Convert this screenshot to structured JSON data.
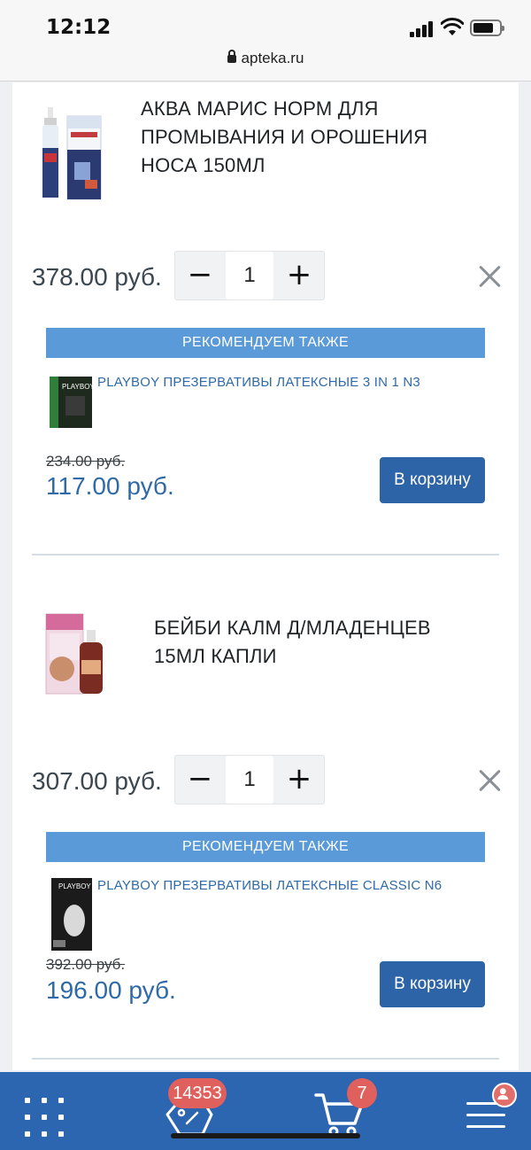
{
  "status_bar": {
    "time": "12:12",
    "url": "apteka.ru",
    "battery_level": 0.8
  },
  "products": [
    {
      "name": "АКВА МАРИС НОРМ ДЛЯ ПРОМЫВАНИЯ И ОРОШЕНИЯ НОСА 150МЛ",
      "thumb_icon": "nasal-spray-product-icon",
      "price": "378.00 руб.",
      "quantity": "1",
      "minus_label": "−",
      "plus_label": "+",
      "recommend_header": "РЕКОМЕНДУЕМ ТАКЖЕ",
      "recommended": {
        "name": "PLAYBOY ПРЕЗЕРВАТИВЫ ЛАТЕКСНЫЕ 3 IN 1 N3",
        "old_price": "234.00 руб.",
        "new_price": "117.00 руб.",
        "button": "В корзину"
      }
    },
    {
      "name": "БЕЙБИ КАЛМ Д/МЛАДЕНЦЕВ 15МЛ КАПЛИ",
      "thumb_icon": "drops-bottle-product-icon",
      "price": "307.00 руб.",
      "quantity": "1",
      "minus_label": "−",
      "plus_label": "+",
      "recommend_header": "РЕКОМЕНДУЕМ ТАКЖЕ",
      "recommended": {
        "name": "PLAYBOY ПРЕЗЕРВАТИВЫ ЛАТЕКСНЫЕ CLASSIC N6",
        "old_price": "392.00 руб.",
        "new_price": "196.00 руб.",
        "button": "В корзину"
      }
    }
  ],
  "bottom_nav": {
    "promo_badge": "14353",
    "cart_badge": "7",
    "icons": [
      "grid-menu-icon",
      "promo-tag-icon",
      "cart-icon",
      "hamburger-menu-icon"
    ]
  },
  "colors": {
    "accent": "#2c66b0",
    "recommend_bar": "#5b9ad8",
    "badge": "#e0605d",
    "price_blue": "#2f6aa8"
  }
}
